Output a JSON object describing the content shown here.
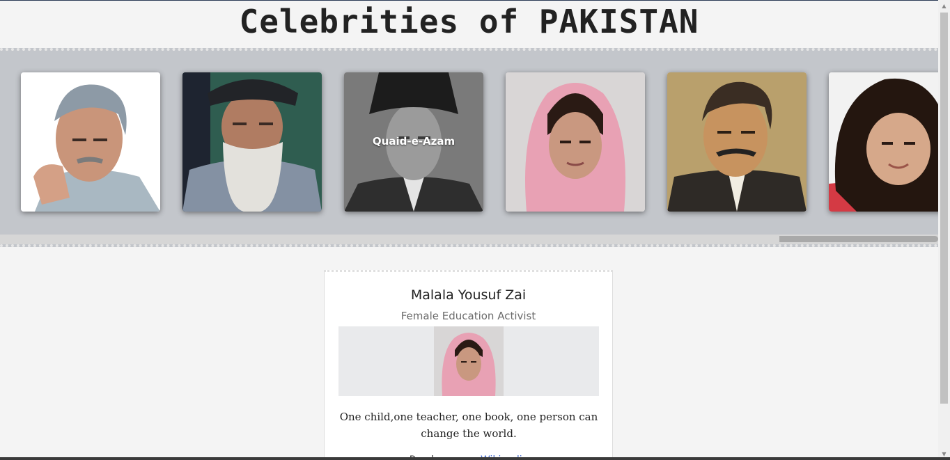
{
  "header": {
    "title": "Celebrities of PAKISTAN"
  },
  "carousel": {
    "cards": [
      {
        "caption": "",
        "portrait": "abdul-qadeer-khan"
      },
      {
        "caption": "",
        "portrait": "abdul-sattar-edhi"
      },
      {
        "caption": "Quaid-e-Azam",
        "portrait": "quaid-e-azam"
      },
      {
        "caption": "",
        "portrait": "malala-yousufzai"
      },
      {
        "caption": "",
        "portrait": "allama-iqbal"
      },
      {
        "caption": "",
        "portrait": "arfa-karim"
      }
    ]
  },
  "detail": {
    "name": "Malala Yousuf Zai",
    "role": "Female Education Activist",
    "quote": "One child,one teacher, one book, one person can change the world.",
    "read_more_prefix": "Read more on",
    "read_more_link": "Wikipedia"
  },
  "colors": {
    "carousel_bg": "#c3c6cb",
    "link": "#4a6fd1"
  }
}
